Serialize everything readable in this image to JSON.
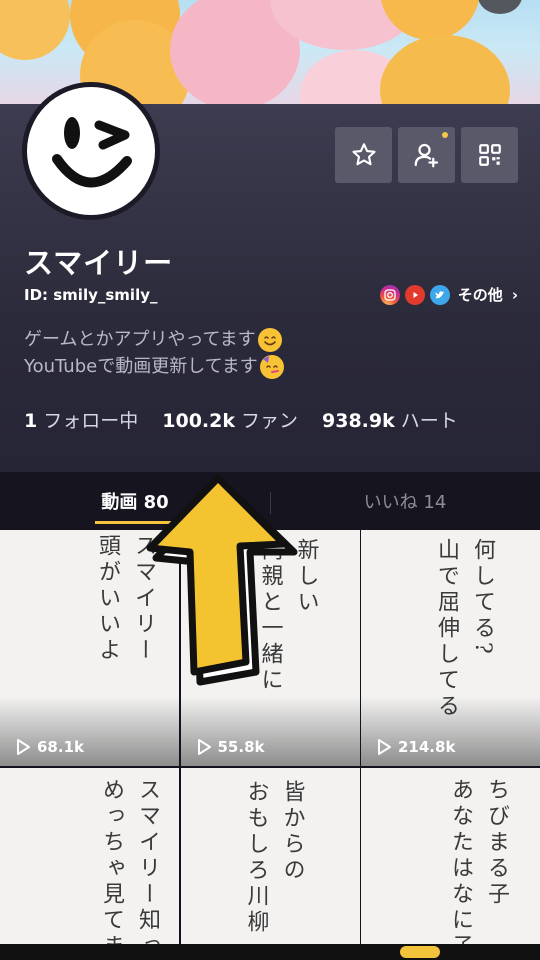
{
  "profile": {
    "name": "スマイリー",
    "id": "ID: smily_smily_",
    "more_label": "その他",
    "bio": [
      "ゲームとかアプリやってます",
      "YouTubeで動画更新してます"
    ]
  },
  "stats": [
    {
      "value": "1",
      "label": "フォロー中"
    },
    {
      "value": "100.2k",
      "label": "ファン"
    },
    {
      "value": "938.9k",
      "label": "ハート"
    }
  ],
  "tabs": {
    "videos": "動画 80",
    "likes": "いいね 14"
  },
  "icons": {
    "favorite": "star-icon",
    "add_friend": "add-user-icon",
    "qr": "qr-code-icon",
    "instagram": "instagram-icon",
    "youtube": "youtube-icon",
    "twitter": "twitter-icon"
  },
  "colors": {
    "accent": "#f2c33b",
    "panel": "#2b2a3a",
    "tabbar": "#16141f"
  },
  "videos": [
    {
      "views": "68.1k",
      "text": "スマイリー\n頭がいいよ"
    },
    {
      "views": "55.8k",
      "text": "新しい\n両親と一緒に"
    },
    {
      "views": "214.8k",
      "text": "何してる?\n山で屈伸してる"
    },
    {
      "views": "",
      "text": "スマイリー知って\nめっちゃ見てま"
    },
    {
      "views": "",
      "text": "皆からの\nおもしろ川柳"
    },
    {
      "views": "",
      "text": "ちびまる子\nあなたはなに子"
    }
  ]
}
